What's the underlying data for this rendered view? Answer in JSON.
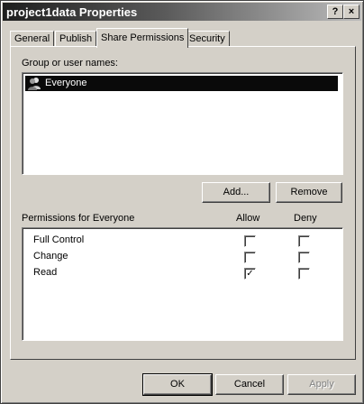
{
  "window": {
    "title": "project1data Properties",
    "help_label": "?",
    "close_label": "×"
  },
  "tabs": [
    {
      "label": "General"
    },
    {
      "label": "Publish"
    },
    {
      "label": "Share Permissions",
      "active": true
    },
    {
      "label": "Security"
    }
  ],
  "groups": {
    "label": "Group or user names:",
    "items": [
      {
        "name": "Everyone",
        "selected": true
      }
    ]
  },
  "buttons": {
    "add": "Add...",
    "remove": "Remove",
    "ok": "OK",
    "cancel": "Cancel",
    "apply": "Apply"
  },
  "permissions": {
    "header": "Permissions for Everyone",
    "allow_label": "Allow",
    "deny_label": "Deny",
    "rows": [
      {
        "name": "Full Control",
        "allow": false,
        "deny": false
      },
      {
        "name": "Change",
        "allow": false,
        "deny": false
      },
      {
        "name": "Read",
        "allow": true,
        "deny": false
      }
    ]
  },
  "icons": {
    "user_group": "users-icon",
    "checkmark": "✓"
  }
}
